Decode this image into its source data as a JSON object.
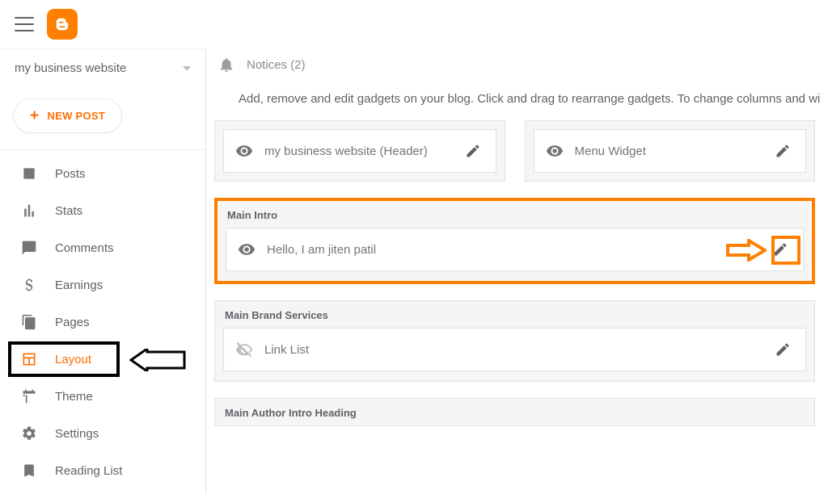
{
  "header": {
    "blog_name": "my business website",
    "new_post_label": "NEW POST"
  },
  "sidebar": {
    "items": [
      {
        "label": "Posts"
      },
      {
        "label": "Stats"
      },
      {
        "label": "Comments"
      },
      {
        "label": "Earnings"
      },
      {
        "label": "Pages"
      },
      {
        "label": "Layout"
      },
      {
        "label": "Theme"
      },
      {
        "label": "Settings"
      },
      {
        "label": "Reading List"
      }
    ]
  },
  "notices": {
    "label": "Notices (2)"
  },
  "instruction": "Add, remove and edit gadgets on your blog. Click and drag to rearrange gadgets. To change columns and wi",
  "sections": {
    "row1": [
      {
        "gadget_label": "my business website (Header)"
      },
      {
        "gadget_label": "Menu Widget"
      }
    ],
    "main_intro": {
      "title": "Main Intro",
      "gadget_label": "Hello, I am jiten patil"
    },
    "main_brand": {
      "title": "Main Brand Services",
      "gadget_label": "Link List"
    },
    "main_author": {
      "title": "Main Author Intro Heading"
    }
  }
}
